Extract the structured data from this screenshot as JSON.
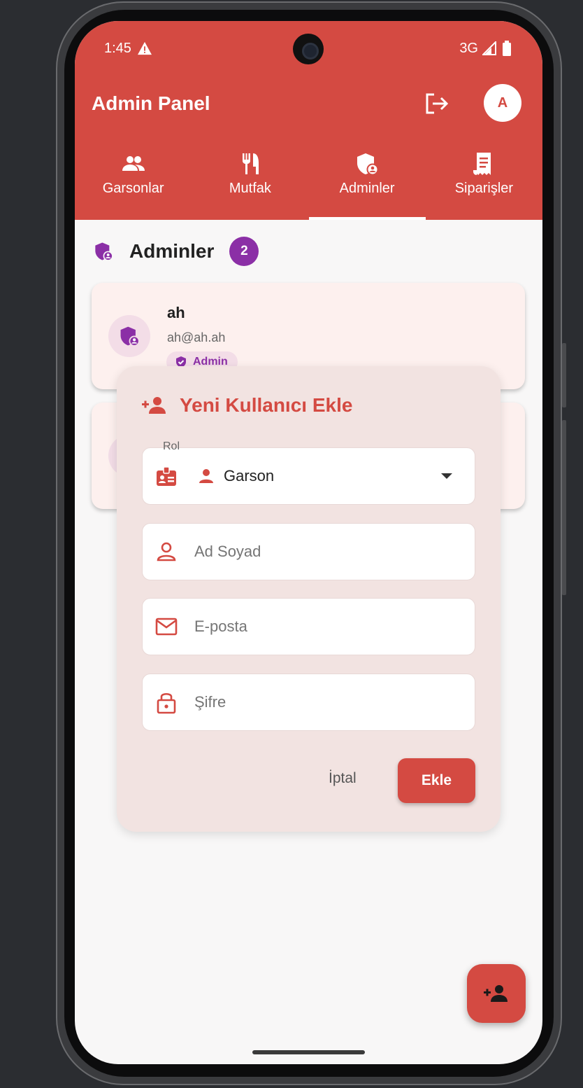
{
  "status_bar": {
    "time": "1:45",
    "network": "3G"
  },
  "app_bar": {
    "title": "Admin Panel",
    "avatar_initial": "A"
  },
  "tabs": [
    {
      "label": "Garsonlar",
      "icon": "people-icon"
    },
    {
      "label": "Mutfak",
      "icon": "utensils-icon"
    },
    {
      "label": "Adminler",
      "icon": "admin-shield-icon",
      "active": true
    },
    {
      "label": "Siparişler",
      "icon": "receipt-icon"
    }
  ],
  "section": {
    "title": "Adminler",
    "count": "2"
  },
  "admins": [
    {
      "name": "ah",
      "email": "ah@ah.ah",
      "role": "Admin"
    }
  ],
  "dialog": {
    "title": "Yeni Kullanıcı Ekle",
    "role_label": "Rol",
    "role_value": "Garson",
    "name_placeholder": "Ad Soyad",
    "email_placeholder": "E-posta",
    "password_placeholder": "Şifre",
    "cancel_label": "İptal",
    "submit_label": "Ekle"
  },
  "colors": {
    "primary": "#d44a42",
    "admin_purple": "#8b2fa6",
    "card_bg": "#fdf0ee",
    "dialog_bg": "#f2e3e1"
  }
}
